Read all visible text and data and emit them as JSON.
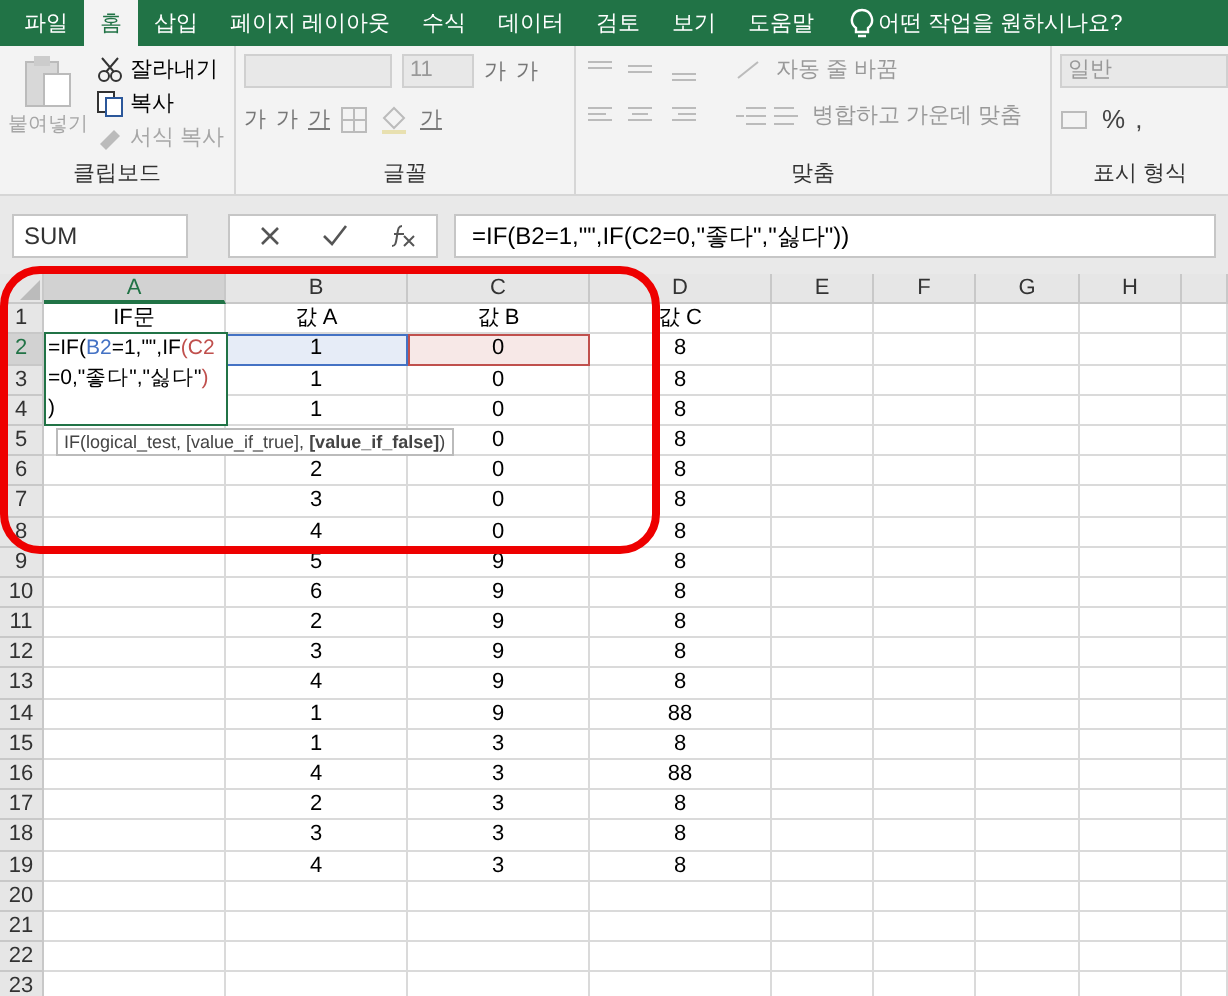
{
  "ribbon_tabs": [
    {
      "label": "파일",
      "selected": false
    },
    {
      "label": "홈",
      "selected": true
    },
    {
      "label": "삽입",
      "selected": false
    },
    {
      "label": "페이지 레이아웃",
      "selected": false
    },
    {
      "label": "수식",
      "selected": false
    },
    {
      "label": "데이터",
      "selected": false
    },
    {
      "label": "검토",
      "selected": false
    },
    {
      "label": "보기",
      "selected": false
    },
    {
      "label": "도움말",
      "selected": false
    }
  ],
  "tell_me": {
    "placeholder": "어떤 작업을 원하시나요?"
  },
  "clipboard": {
    "label": "클립보드",
    "paste": {
      "label": "붙여넣기",
      "disabled": true
    },
    "items": [
      {
        "kind": "cut",
        "label": "잘라내기",
        "disabled": false
      },
      {
        "kind": "copy",
        "label": "복사",
        "disabled": false
      },
      {
        "kind": "format",
        "label": "서식 복사",
        "disabled": true
      }
    ]
  },
  "font": {
    "label": "글꼴",
    "size": "11",
    "grow": "가",
    "shrink": "가",
    "styles": [
      "가",
      "가",
      "가"
    ],
    "font_color": "가"
  },
  "alignment": {
    "label": "맞춤",
    "wrap": "자동 줄 바꿈",
    "merge": "병합하고 가운데 맞춤"
  },
  "number": {
    "label": "표시 형식",
    "format": "일반",
    "percent": "%",
    "comma": ","
  },
  "name_box": "SUM",
  "formula": "=IF(B2=1,\"\",IF(C2=0,\"좋다\",\"싫다\"))",
  "columns": [
    {
      "label": "A",
      "selected": true
    },
    {
      "label": "B",
      "selected": false
    },
    {
      "label": "C",
      "selected": false
    },
    {
      "label": "D",
      "selected": false
    },
    {
      "label": "E",
      "selected": false
    },
    {
      "label": "F",
      "selected": false
    },
    {
      "label": "G",
      "selected": false
    },
    {
      "label": "H",
      "selected": false
    }
  ],
  "rows": [
    {
      "header": "1",
      "selected": false,
      "cells": [
        {
          "text": "IF문"
        },
        {
          "text": "값 A"
        },
        {
          "text": "값 B"
        },
        {
          "text": "값 C"
        }
      ]
    },
    {
      "header": "2",
      "selected": true,
      "cells": [
        {
          "kind": "editor"
        },
        {
          "text": "1",
          "color": "#4472c4"
        },
        {
          "text": "0",
          "color": "#c0504d"
        },
        {
          "text": "8"
        }
      ]
    },
    {
      "header": "3",
      "selected": false,
      "cells": [
        {
          "kind": "covered"
        },
        {
          "text": "1"
        },
        {
          "text": "0"
        },
        {
          "text": "8"
        }
      ]
    },
    {
      "header": "4",
      "selected": false,
      "cells": [
        {
          "kind": "covered"
        },
        {
          "text": "1"
        },
        {
          "text": "0"
        },
        {
          "text": "8"
        }
      ]
    },
    {
      "header": "5",
      "selected": false,
      "cells": [
        null,
        null,
        {
          "text": "0"
        },
        {
          "text": "8"
        }
      ]
    },
    {
      "header": "6",
      "selected": false,
      "cells": [
        null,
        {
          "text": "2"
        },
        {
          "text": "0"
        },
        {
          "text": "8"
        }
      ]
    },
    {
      "header": "7",
      "selected": false,
      "cells": [
        null,
        {
          "text": "3"
        },
        {
          "text": "0"
        },
        {
          "text": "8"
        }
      ]
    },
    {
      "header": "8",
      "selected": false,
      "cells": [
        null,
        {
          "text": "4"
        },
        {
          "text": "0"
        },
        {
          "text": "8"
        }
      ]
    },
    {
      "header": "9",
      "selected": false,
      "cells": [
        null,
        {
          "text": "5"
        },
        {
          "text": "9"
        },
        {
          "text": "8"
        }
      ]
    },
    {
      "header": "10",
      "selected": false,
      "cells": [
        null,
        {
          "text": "6"
        },
        {
          "text": "9"
        },
        {
          "text": "8"
        }
      ]
    },
    {
      "header": "11",
      "selected": false,
      "cells": [
        null,
        {
          "text": "2"
        },
        {
          "text": "9"
        },
        {
          "text": "8"
        }
      ]
    },
    {
      "header": "12",
      "selected": false,
      "cells": [
        null,
        {
          "text": "3"
        },
        {
          "text": "9"
        },
        {
          "text": "8"
        }
      ]
    },
    {
      "header": "13",
      "selected": false,
      "cells": [
        null,
        {
          "text": "4"
        },
        {
          "text": "9"
        },
        {
          "text": "8"
        }
      ]
    },
    {
      "header": "14",
      "selected": false,
      "cells": [
        null,
        {
          "text": "1"
        },
        {
          "text": "9"
        },
        {
          "text": "88"
        }
      ]
    },
    {
      "header": "15",
      "selected": false,
      "cells": [
        null,
        {
          "text": "1"
        },
        {
          "text": "3"
        },
        {
          "text": "8"
        }
      ]
    },
    {
      "header": "16",
      "selected": false,
      "cells": [
        null,
        {
          "text": "4"
        },
        {
          "text": "3"
        },
        {
          "text": "88"
        }
      ]
    },
    {
      "header": "17",
      "selected": false,
      "cells": [
        null,
        {
          "text": "2"
        },
        {
          "text": "3"
        },
        {
          "text": "8"
        }
      ]
    },
    {
      "header": "18",
      "selected": false,
      "cells": [
        null,
        {
          "text": "3"
        },
        {
          "text": "3"
        },
        {
          "text": "8"
        }
      ]
    },
    {
      "header": "19",
      "selected": false,
      "cells": [
        null,
        {
          "text": "4"
        },
        {
          "text": "3"
        },
        {
          "text": "8"
        }
      ]
    },
    {
      "header": "20",
      "selected": false,
      "cells": []
    },
    {
      "header": "21",
      "selected": false,
      "cells": []
    },
    {
      "header": "22",
      "selected": false,
      "cells": []
    },
    {
      "header": "23",
      "selected": false,
      "cells": []
    }
  ],
  "cell_editor": {
    "lines": [
      [
        {
          "text": "=IF("
        },
        {
          "text": "B2",
          "color": "#4472c4"
        },
        {
          "text": "=1,\"\",IF"
        },
        {
          "text": "(C2",
          "color": "#c0504d"
        }
      ],
      [
        {
          "text": "=0,\"좋다\",\"싫다\""
        },
        {
          "text": ")",
          "color": "#c0504d"
        }
      ],
      [
        {
          "text": ")"
        }
      ]
    ]
  },
  "tooltip": "IF(logical_test, [value_if_true], **[value_if_false]**)"
}
